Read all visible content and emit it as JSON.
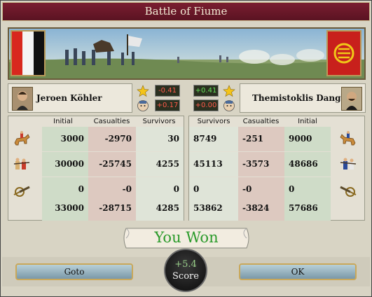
{
  "window": {
    "title": "Battle of Fiume"
  },
  "left": {
    "commander": "Jeroen Köhler",
    "modifiers": [
      "-0.41",
      "+0.17"
    ],
    "rows": [
      {
        "initial": "3000",
        "casualties": "-2970",
        "survivors": "30"
      },
      {
        "initial": "30000",
        "casualties": "-25745",
        "survivors": "4255"
      },
      {
        "initial": "0",
        "casualties": "-0",
        "survivors": "0"
      },
      {
        "initial": "33000",
        "casualties": "-28715",
        "survivors": "4285"
      }
    ]
  },
  "right": {
    "commander": "Themistoklis Danglis",
    "modifiers": [
      "+0.41",
      "+0.00"
    ],
    "rows": [
      {
        "survivors": "8749",
        "casualties": "-251",
        "initial": "9000"
      },
      {
        "survivors": "45113",
        "casualties": "-3573",
        "initial": "48686"
      },
      {
        "survivors": "0",
        "casualties": "-0",
        "initial": "0"
      },
      {
        "survivors": "53862",
        "casualties": "-3824",
        "initial": "57686"
      }
    ]
  },
  "headers": {
    "initial": "Initial",
    "casualties": "Casualties",
    "survivors": "Survivors"
  },
  "result": {
    "text": "You Won"
  },
  "score": {
    "value": "+5.4",
    "label": "Score"
  },
  "buttons": {
    "goto": "Goto",
    "ok": "OK"
  },
  "units": [
    "cavalry-icon",
    "infantry-icon",
    "artillery-icon"
  ],
  "colors": {
    "title_bg": "#6a1828",
    "won_text": "#2a9a2a",
    "negative": "#ff5a4a",
    "positive": "#66e05a"
  }
}
